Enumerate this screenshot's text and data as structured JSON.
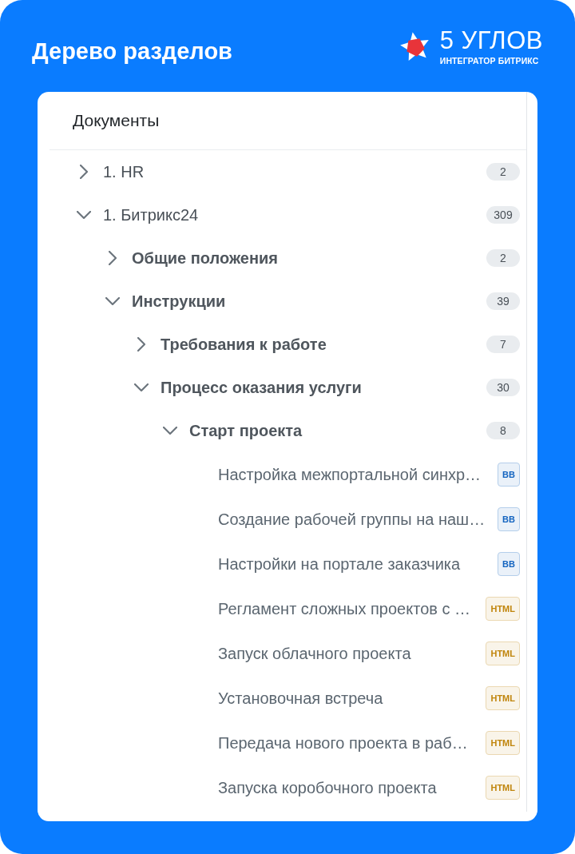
{
  "header": {
    "title": "Дерево разделов",
    "logo": {
      "name": "5 УГЛОВ",
      "tagline": "ИНТЕГРАТОР БИТРИКС"
    }
  },
  "panel": {
    "title": "Документы",
    "tree": [
      {
        "kind": "folder",
        "label": "1. HR",
        "count": "2",
        "expanded": false
      },
      {
        "kind": "folder",
        "label": "1. Битрикс24",
        "count": "309",
        "expanded": true,
        "children": [
          {
            "kind": "folder",
            "label": "Общие положения",
            "count": "2",
            "expanded": false
          },
          {
            "kind": "folder",
            "label": "Инструкции",
            "count": "39",
            "expanded": true,
            "children": [
              {
                "kind": "folder",
                "label": "Требования к работе",
                "count": "7",
                "expanded": false
              },
              {
                "kind": "folder",
                "label": "Процесс оказания услуги",
                "count": "30",
                "expanded": true,
                "children": [
                  {
                    "kind": "folder",
                    "label": "Старт проекта",
                    "count": "8",
                    "expanded": true,
                    "children": [
                      {
                        "kind": "document",
                        "label": "Настройка межпортальной синхр…",
                        "tag": {
                          "text": "BB",
                          "color": "#1565c0"
                        }
                      },
                      {
                        "kind": "document",
                        "label": "Создание рабочей группы на наш…",
                        "tag": {
                          "text": "BB",
                          "color": "#1565c0"
                        }
                      },
                      {
                        "kind": "document",
                        "label": "Настройки на портале заказчика",
                        "tag": {
                          "text": "BB",
                          "color": "#1565c0"
                        }
                      },
                      {
                        "kind": "document",
                        "label": "Регламент сложных проектов с …",
                        "tag": {
                          "text": "HTML",
                          "color": "#c0850c"
                        }
                      },
                      {
                        "kind": "document",
                        "label": "Запуск облачного проекта",
                        "tag": {
                          "text": "HTML",
                          "color": "#c0850c"
                        }
                      },
                      {
                        "kind": "document",
                        "label": "Установочная встреча",
                        "tag": {
                          "text": "HTML",
                          "color": "#c0850c"
                        }
                      },
                      {
                        "kind": "document",
                        "label": "Передача нового проекта в раб…",
                        "tag": {
                          "text": "HTML",
                          "color": "#c0850c"
                        }
                      },
                      {
                        "kind": "document",
                        "label": "Запуска коробочного проекта",
                        "tag": {
                          "text": "HTML",
                          "color": "#c0850c"
                        }
                      }
                    ]
                  }
                ]
              }
            ]
          }
        ]
      }
    ]
  }
}
